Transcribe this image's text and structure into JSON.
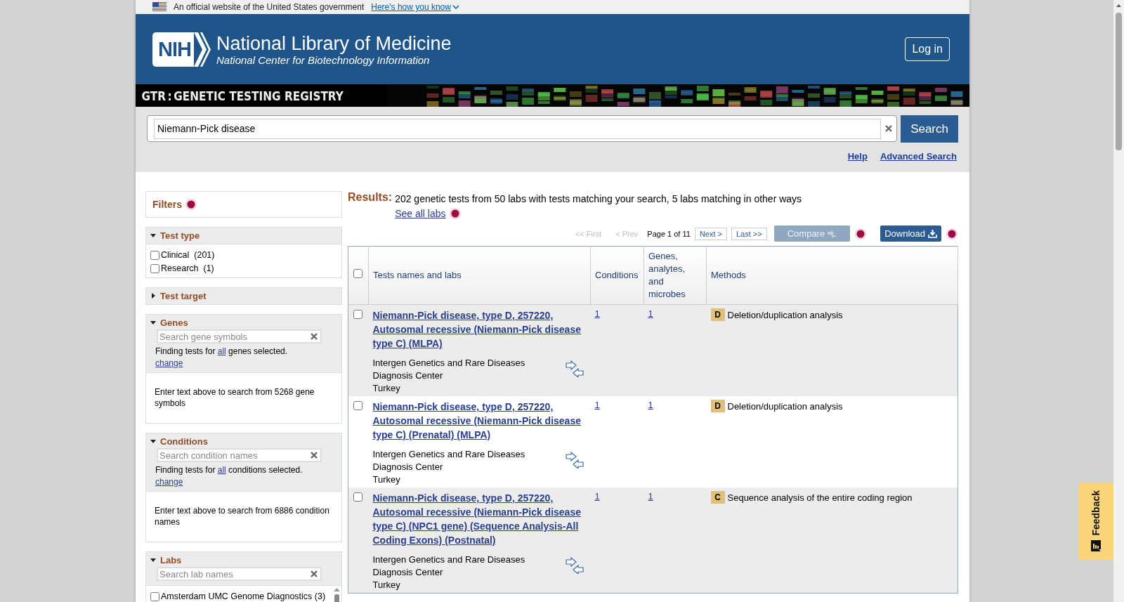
{
  "gov_banner": {
    "text": "An official website of the United States government",
    "link": "Here's how you know"
  },
  "header": {
    "logo": "NIH",
    "title": "National Library of Medicine",
    "subtitle": "National Center for Biotechnology Information",
    "login": "Log in"
  },
  "banner": {
    "prefix": "GTR",
    "separator": ":",
    "title": "GENETIC TESTING REGISTRY"
  },
  "search": {
    "value": "Niemann-Pick disease",
    "button": "Search",
    "links": [
      "Help",
      "Advanced Search"
    ]
  },
  "sidebar": {
    "title": "Filters",
    "sections": [
      {
        "kind": "checklist",
        "title": "Test type",
        "expanded": true,
        "options": [
          {
            "label": "Clinical",
            "count": "(201)",
            "checked": false
          },
          {
            "label": "Research",
            "count": "(1)",
            "checked": false
          }
        ]
      },
      {
        "kind": "checklist",
        "title": "Test target",
        "expanded": false
      },
      {
        "kind": "search",
        "title": "Genes",
        "expanded": true,
        "placeholder": "Search gene symbols",
        "note_before": "Finding tests for ",
        "note_link": "all",
        "note_after": " genes selected.",
        "change": "change",
        "hint": "Enter text above to search from 5268 gene symbols"
      },
      {
        "kind": "search",
        "title": "Conditions",
        "expanded": true,
        "placeholder": "Search condition names",
        "note_before": "Finding tests for ",
        "note_link": "all",
        "note_after": " conditions selected.",
        "change": "change",
        "hint": "Enter text above to search from 6886 condition names"
      },
      {
        "kind": "search-list",
        "title": "Labs",
        "expanded": true,
        "placeholder": "Search lab names",
        "options": [
          {
            "label": "Amsterdam UMC Genome Diagnostics (3)",
            "checked": false
          }
        ]
      }
    ]
  },
  "results": {
    "label": "Results:",
    "summary": "202 genetic tests from 50 labs with tests matching your search, 5 labs matching in other ways",
    "see_all": "See all labs",
    "pager": {
      "first": "<< First",
      "prev": "< Prev",
      "page": "Page 1 of 11",
      "next": "Next >",
      "last": "Last >>",
      "first_disabled": true,
      "prev_disabled": true
    },
    "compare": {
      "label": "Compare",
      "disabled": true
    },
    "download": "Download"
  },
  "table": {
    "all_checked": false,
    "columns": [
      "Tests names and labs",
      "Conditions",
      "Genes, analytes, and microbes",
      "Methods"
    ],
    "rows": [
      {
        "checked": false,
        "title": "Niemann-Pick disease, type D, 257220, Autosomal recessive (Niemann-Pick disease type C) (MLPA)",
        "lab": "Intergen Genetics and Rare Diseases Diagnosis Center",
        "country": "Turkey",
        "conditions": "1",
        "genes": "1",
        "method_code": "D",
        "method": "Deletion/duplication analysis"
      },
      {
        "checked": false,
        "title": "Niemann-Pick disease, type D, 257220, Autosomal recessive (Niemann-Pick disease type C) (Prenatal) (MLPA)",
        "lab": "Intergen Genetics and Rare Diseases Diagnosis Center",
        "country": "Turkey",
        "conditions": "1",
        "genes": "1",
        "method_code": "D",
        "method": "Deletion/duplication analysis"
      },
      {
        "checked": false,
        "title": "Niemann-Pick disease, type D, 257220, Autosomal recessive (Niemann-Pick disease type C) (NPC1 gene) (Sequence Analysis-All Coding Exons) (Postnatal)",
        "lab": "Intergen Genetics and Rare Diseases Diagnosis Center",
        "country": "Turkey",
        "conditions": "1",
        "genes": "1",
        "method_code": "C",
        "method": "Sequence analysis of the entire coding region"
      }
    ]
  },
  "feedback": "Feedback"
}
